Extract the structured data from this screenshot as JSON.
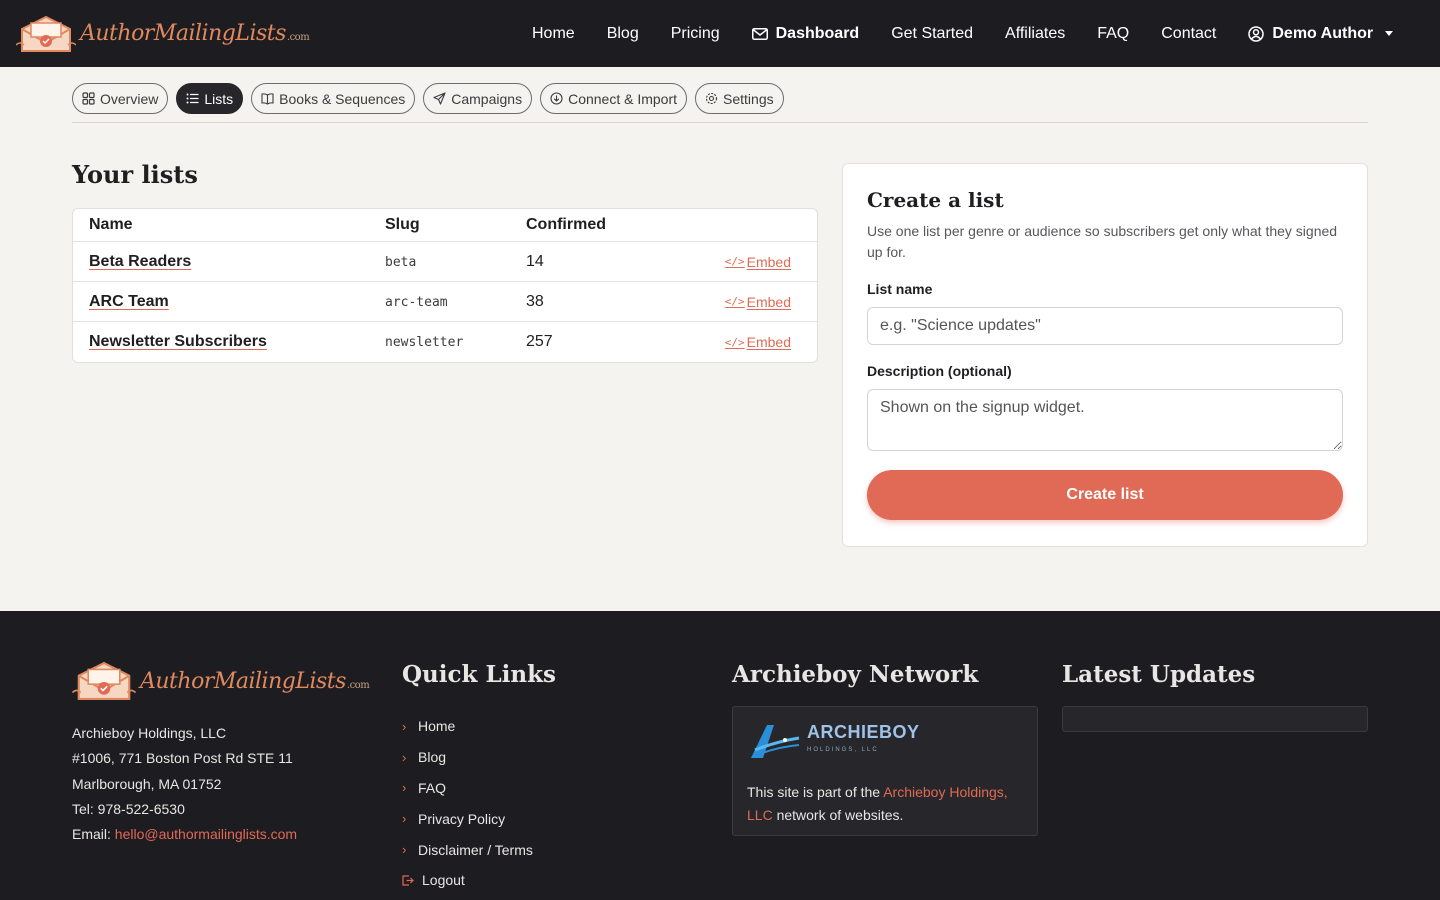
{
  "brand": {
    "name": "AuthorMailingLists",
    "tld": ".com"
  },
  "nav": {
    "home": "Home",
    "blog": "Blog",
    "pricing": "Pricing",
    "dashboard": "Dashboard",
    "get_started": "Get Started",
    "affiliates": "Affiliates",
    "faq": "FAQ",
    "contact": "Contact",
    "user": "Demo Author"
  },
  "tabs": [
    {
      "label": "Overview",
      "icon": "grid-icon"
    },
    {
      "label": "Lists",
      "icon": "list-icon",
      "active": true
    },
    {
      "label": "Books & Sequences",
      "icon": "book-icon"
    },
    {
      "label": "Campaigns",
      "icon": "send-icon"
    },
    {
      "label": "Connect & Import",
      "icon": "download-icon"
    },
    {
      "label": "Settings",
      "icon": "gear-icon"
    }
  ],
  "lists": {
    "title": "Your lists",
    "columns": {
      "name": "Name",
      "slug": "Slug",
      "confirmed": "Confirmed"
    },
    "rows": [
      {
        "name": "Beta Readers",
        "slug": "beta",
        "confirmed": "14",
        "embed": "Embed"
      },
      {
        "name": "ARC Team",
        "slug": "arc-team",
        "confirmed": "38",
        "embed": "Embed"
      },
      {
        "name": "Newsletter Subscribers",
        "slug": "newsletter",
        "confirmed": "257",
        "embed": "Embed"
      }
    ]
  },
  "create": {
    "title": "Create a list",
    "help": "Use one list per genre or audience so subscribers get only what they signed up for.",
    "name_label": "List name",
    "name_placeholder": "e.g. \"Science updates\"",
    "desc_label": "Description (optional)",
    "desc_placeholder": "Shown on the signup widget.",
    "button": "Create list"
  },
  "footer": {
    "company": "Archieboy Holdings, LLC",
    "address1": "#1006, 771 Boston Post Rd STE 11",
    "address2": "Marlborough, MA 01752",
    "tel": "Tel: 978-522-6530",
    "email_label": "Email:",
    "email": "hello@authormailinglists.com",
    "quick_links_title": "Quick Links",
    "quick_links": [
      "Home",
      "Blog",
      "FAQ",
      "Privacy Policy",
      "Disclaimer / Terms",
      "Logout"
    ],
    "network_title": "Archieboy Network",
    "network_logo": "ARCHIEBOY",
    "network_logo_sub": "HOLDINGS, LLC",
    "network_text_pre": "This site is part of the",
    "network_link": "Archieboy Holdings, LLC",
    "network_text_post": "network of websites.",
    "updates_title": "Latest Updates"
  },
  "colors": {
    "accent": "#e06a55",
    "dark": "#1d1c20",
    "page_bg": "#f5f3ef"
  }
}
